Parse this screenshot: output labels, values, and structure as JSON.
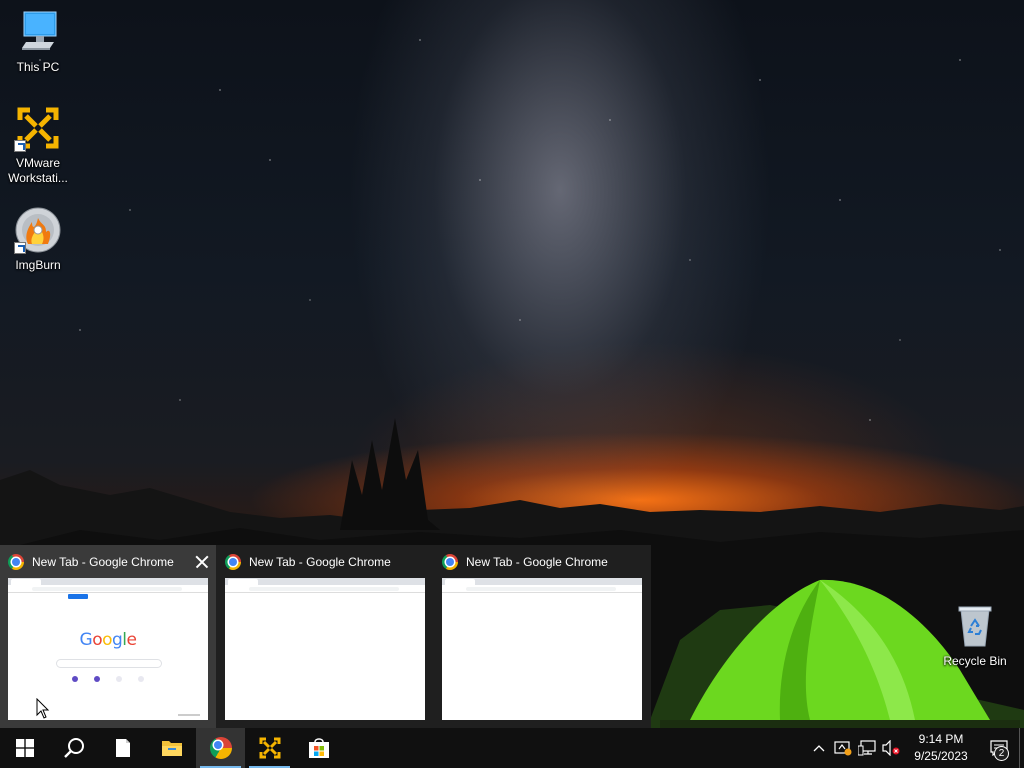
{
  "desktop": {
    "icons": [
      {
        "label": "This PC"
      },
      {
        "label": "VMware Workstati..."
      },
      {
        "label": "ImgBurn"
      },
      {
        "label": "Recycle Bin"
      }
    ]
  },
  "taskbar_preview": {
    "thumbnails": [
      {
        "title": "New Tab - Google Chrome",
        "hovered": true
      },
      {
        "title": "New Tab - Google Chrome",
        "hovered": false
      },
      {
        "title": "New Tab - Google Chrome",
        "hovered": false
      }
    ],
    "google_logo": [
      "G",
      "o",
      "o",
      "g",
      "l",
      "e"
    ]
  },
  "taskbar": {
    "buttons": [
      {
        "icon": "windows-start-icon"
      },
      {
        "icon": "search-icon"
      },
      {
        "icon": "notepad-icon"
      },
      {
        "icon": "file-explorer-icon"
      },
      {
        "icon": "chrome-icon",
        "active": true
      },
      {
        "icon": "vmware-icon"
      },
      {
        "icon": "microsoft-store-icon"
      }
    ],
    "tray": {
      "time": "9:14 PM",
      "date": "9/25/2023",
      "notification_count": "2"
    }
  },
  "colors": {
    "taskbar": "#101010",
    "accent": "#76b9ed",
    "preview_bg": "#202020"
  }
}
